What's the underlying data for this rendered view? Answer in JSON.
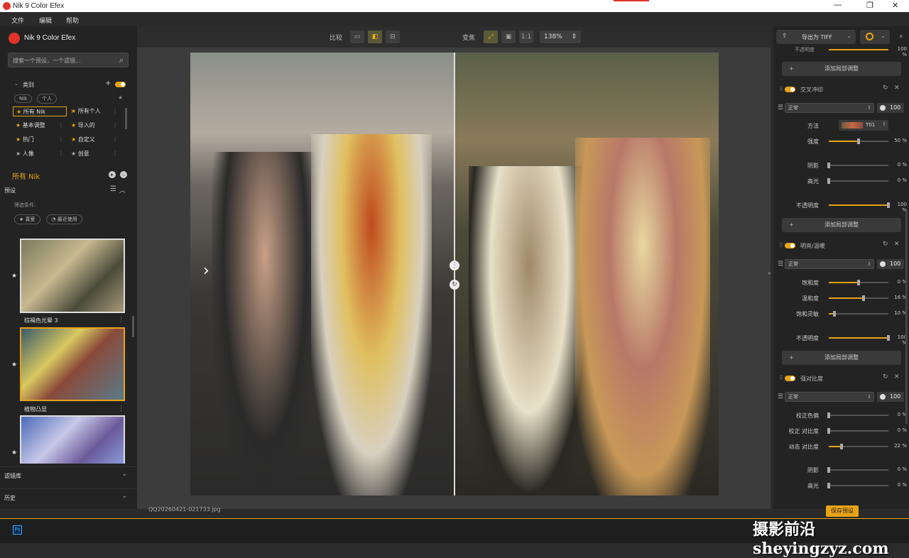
{
  "window": {
    "title": "Nik 9 Color Efex",
    "min": "—",
    "max": "❐",
    "close": "✕"
  },
  "menu": [
    "文件",
    "编辑",
    "帮助"
  ],
  "left": {
    "brand": "Nik 9 Color Efex",
    "search_placeholder": "搜索一个预设，一个滤镜...",
    "category_title": "类别",
    "pills": [
      "Nik",
      "个人"
    ],
    "categories": [
      {
        "label": "所有 Nik",
        "starred": true,
        "selected": true
      },
      {
        "label": "所有个人",
        "starred": true,
        "selected": false
      },
      {
        "label": "基本调整",
        "starred": true,
        "selected": false
      },
      {
        "label": "导入的",
        "starred": true,
        "selected": false
      },
      {
        "label": "热门",
        "starred": true,
        "selected": false
      },
      {
        "label": "自定义",
        "starred": true,
        "selected": false
      },
      {
        "label": "人像",
        "starred": false,
        "selected": false
      },
      {
        "label": "创意",
        "starred": false,
        "selected": false
      }
    ],
    "current_group": "所有 Nik",
    "presets_title": "预设",
    "filter_label": "筛选条件:",
    "filter_pills": [
      "喜爱",
      "最近使用"
    ],
    "thumbs": [
      {
        "caption": "棕褐色光晕 3",
        "selected": false
      },
      {
        "caption": "植物凸显",
        "selected": true
      },
      {
        "caption": "",
        "selected": false
      }
    ],
    "sections": [
      "滤镜库",
      "历史"
    ]
  },
  "toolbar": {
    "compare_label": "比较",
    "zoom_label": "变焦",
    "one_to_one": "1:1",
    "zoom_value": "138%"
  },
  "canvas": {
    "filename": "QQ20260421-021733.jpg"
  },
  "right": {
    "export_label": "导出为 TIFF",
    "top_opacity_label": "不透明度",
    "top_opacity_value": "100 %",
    "add_local": "添加局部调整",
    "filters": [
      {
        "name": "交叉冲印",
        "blend": "正常",
        "opacity": "100",
        "method_label": "方法",
        "method_value": "T01",
        "sliders": [
          {
            "label": "强度",
            "value": "50 %",
            "level": 0.5
          },
          {
            "label": "阴影",
            "value": "0 %",
            "level": 0
          },
          {
            "label": "高光",
            "value": "0 %",
            "level": 0
          },
          {
            "label": "不透明度",
            "value": "100 %",
            "level": 1
          }
        ]
      },
      {
        "name": "明亮/温暖",
        "blend": "正常",
        "opacity": "100",
        "sliders": [
          {
            "label": "饱和度",
            "value": "0 %",
            "level": 0.5
          },
          {
            "label": "温和度",
            "value": "16 %",
            "level": 0.58
          },
          {
            "label": "饱和灵敏",
            "value": "10 %",
            "level": 0.1
          },
          {
            "label": "不透明度",
            "value": "100 %",
            "level": 1
          }
        ]
      },
      {
        "name": "强对比度",
        "blend": "正常",
        "opacity": "100",
        "sliders": [
          {
            "label": "校正色偏",
            "value": "0 %",
            "level": 0
          },
          {
            "label": "校正 对比度",
            "value": "0 %",
            "level": 0
          },
          {
            "label": "动态 对比度",
            "value": "22 %",
            "level": 0.22
          },
          {
            "label": "阴影",
            "value": "0 %",
            "level": 0
          },
          {
            "label": "高光",
            "value": "0 %",
            "level": 0
          }
        ]
      }
    ],
    "save_preset": "保存预设"
  },
  "taskbar": {
    "ps": "Ps"
  },
  "watermark": "摄影前沿sheyingzyz.com",
  "colors": {
    "accent": "#e8a317",
    "brand": "#e0342b"
  }
}
